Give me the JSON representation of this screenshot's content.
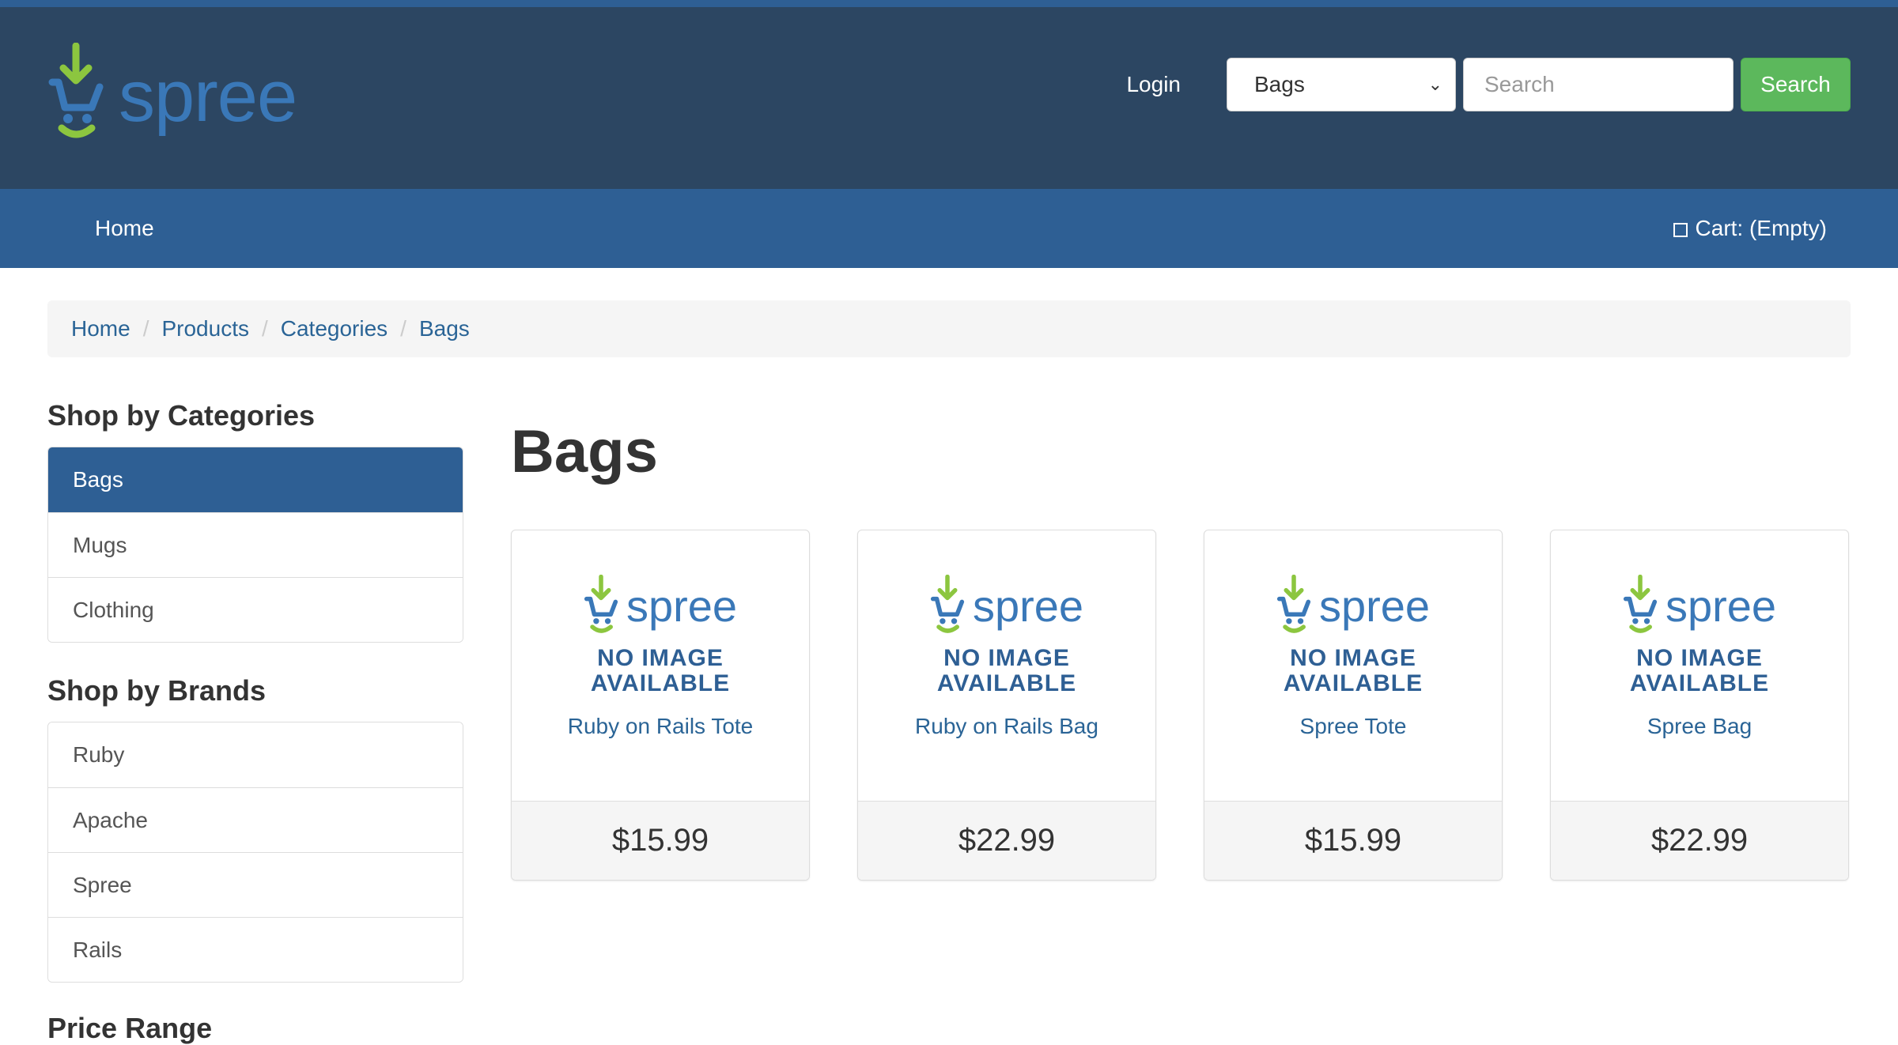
{
  "header": {
    "brand": "spree",
    "login_label": "Login",
    "taxon_select_value": "Bags",
    "search_placeholder": "Search",
    "search_button": "Search"
  },
  "nav": {
    "home_label": "Home",
    "cart_label": "Cart: (Empty)"
  },
  "breadcrumb": [
    "Home",
    "Products",
    "Categories",
    "Bags"
  ],
  "sidebar": {
    "categories_heading": "Shop by Categories",
    "categories": [
      "Bags",
      "Mugs",
      "Clothing"
    ],
    "active_category": "Bags",
    "brands_heading": "Shop by Brands",
    "brands": [
      "Ruby",
      "Apache",
      "Spree",
      "Rails"
    ],
    "cut_heading": "Price Range"
  },
  "main": {
    "title": "Bags",
    "products": [
      {
        "name": "Ruby on Rails Tote",
        "price": "$15.99",
        "placeholder_brand": "spree",
        "placeholder_line1": "NO IMAGE",
        "placeholder_line2": "AVAILABLE"
      },
      {
        "name": "Ruby on Rails Bag",
        "price": "$22.99",
        "placeholder_brand": "spree",
        "placeholder_line1": "NO IMAGE",
        "placeholder_line2": "AVAILABLE"
      },
      {
        "name": "Spree Tote",
        "price": "$15.99",
        "placeholder_brand": "spree",
        "placeholder_line1": "NO IMAGE",
        "placeholder_line2": "AVAILABLE"
      },
      {
        "name": "Spree Bag",
        "price": "$22.99",
        "placeholder_brand": "spree",
        "placeholder_line1": "NO IMAGE",
        "placeholder_line2": "AVAILABLE"
      }
    ]
  },
  "colors": {
    "header_bg": "#2c4662",
    "nav_bg": "#2e5f94",
    "link": "#2a6496",
    "success": "#5cb85c",
    "logo_green": "#8cc63f",
    "logo_blue": "#3a78b8"
  },
  "icons": {
    "logo": "spree-cart-icon",
    "cart": "cart-square-icon",
    "select_chevron": "chevron-down-icon"
  }
}
